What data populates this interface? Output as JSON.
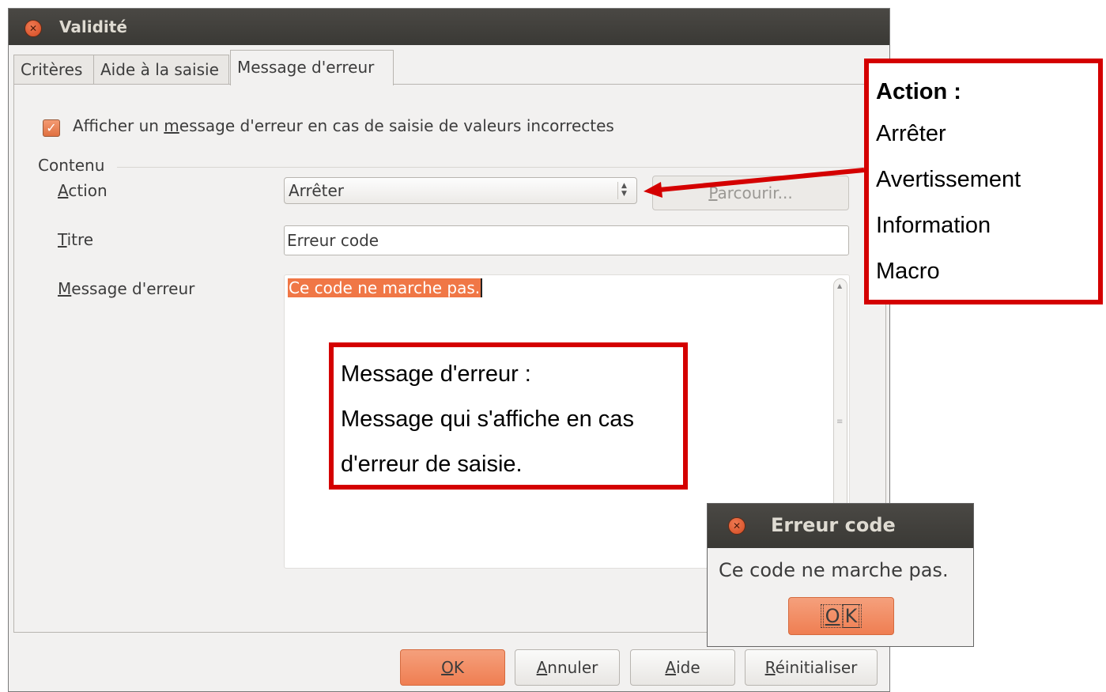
{
  "window": {
    "title": "Validité",
    "close_icon": "close-icon",
    "tabs": [
      {
        "label": "Critères",
        "active": false
      },
      {
        "label": "Aide à la saisie",
        "active": false
      },
      {
        "label": "Message d'erreur",
        "active": true
      }
    ]
  },
  "error_tab": {
    "show_error_checkbox": {
      "checked": true,
      "label_before": "Afficher un ",
      "label_mnemonic": "m",
      "label_after": "essage d'erreur en cas de saisie de valeurs incorrectes"
    },
    "group_label": "Contenu",
    "action": {
      "mnemonic": "A",
      "rest": "ction",
      "value": "Arrêter"
    },
    "browse_button": {
      "mnemonic": "P",
      "rest": "arcourir..."
    },
    "title": {
      "mnemonic": "T",
      "rest": "itre",
      "value": "Erreur code"
    },
    "error_message": {
      "mnemonic": "M",
      "rest": "essage d'erreur",
      "value": "Ce code ne marche pas."
    }
  },
  "buttons": {
    "ok": {
      "mnemonic": "O",
      "rest": "K"
    },
    "cancel": {
      "mnemonic": "A",
      "rest": "nnuler"
    },
    "help": {
      "mnemonic": "A",
      "rest": "ide"
    },
    "reset": {
      "mnemonic": "R",
      "rest": "éinitialiser"
    }
  },
  "error_popup": {
    "title": "Erreur code",
    "message": "Ce code ne marche pas.",
    "ok": {
      "mnemonic": "O",
      "rest": "K"
    }
  },
  "callout_action": {
    "title": "Action :",
    "items": [
      "Arrêter",
      "Avertissement",
      "Information",
      "Macro"
    ]
  },
  "callout_message": {
    "lines": [
      "Message d'erreur :",
      "Message qui s'affiche en cas",
      "d'erreur de saisie."
    ]
  },
  "colors": {
    "accent": "#f07746",
    "callout_border": "#d40000",
    "titlebar": "#3c3b37"
  }
}
